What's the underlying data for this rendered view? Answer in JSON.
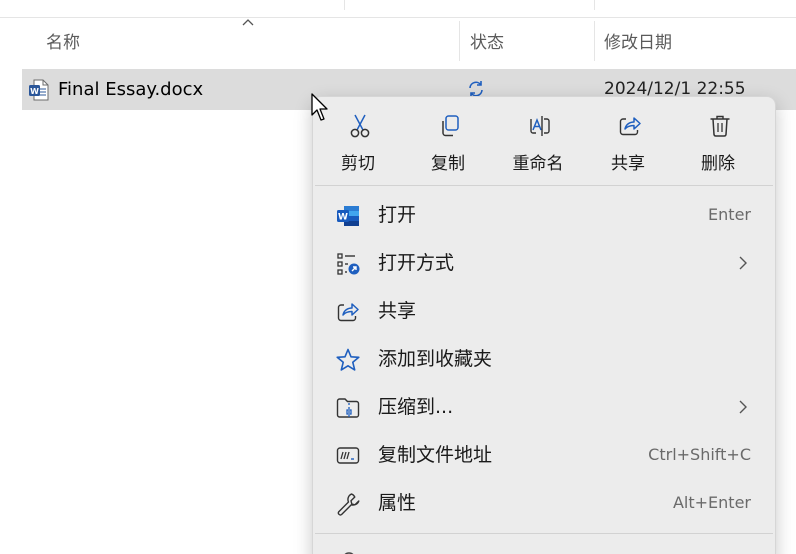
{
  "columns": {
    "name": "名称",
    "status": "状态",
    "modified": "修改日期"
  },
  "file": {
    "name": "Final Essay.docx",
    "modified": "2024/12/1 22:55",
    "icon": "word-doc-icon",
    "status_icon": "sync-pending-icon"
  },
  "context_menu": {
    "quick_actions": [
      {
        "label": "剪切",
        "icon": "cut-icon"
      },
      {
        "label": "复制",
        "icon": "copy-icon"
      },
      {
        "label": "重命名",
        "icon": "rename-icon"
      },
      {
        "label": "共享",
        "icon": "share-icon"
      },
      {
        "label": "删除",
        "icon": "delete-icon"
      }
    ],
    "items": [
      {
        "label": "打开",
        "shortcut": "Enter",
        "icon": "word-app-icon"
      },
      {
        "label": "打开方式",
        "shortcut": "",
        "icon": "open-with-icon",
        "submenu": true
      },
      {
        "label": "共享",
        "shortcut": "",
        "icon": "share-icon"
      },
      {
        "label": "添加到收藏夹",
        "shortcut": "",
        "icon": "star-icon"
      },
      {
        "label": "压缩到...",
        "shortcut": "",
        "icon": "zip-folder-icon",
        "submenu": true
      },
      {
        "label": "复制文件地址",
        "shortcut": "Ctrl+Shift+C",
        "icon": "copy-path-icon"
      },
      {
        "label": "属性",
        "shortcut": "Alt+Enter",
        "icon": "wrench-icon"
      }
    ]
  },
  "colors": {
    "selection": "#dcdcdc",
    "menu_bg": "#ececec",
    "accent_blue": "#1f5fbf",
    "word_blue": "#2b579a"
  }
}
